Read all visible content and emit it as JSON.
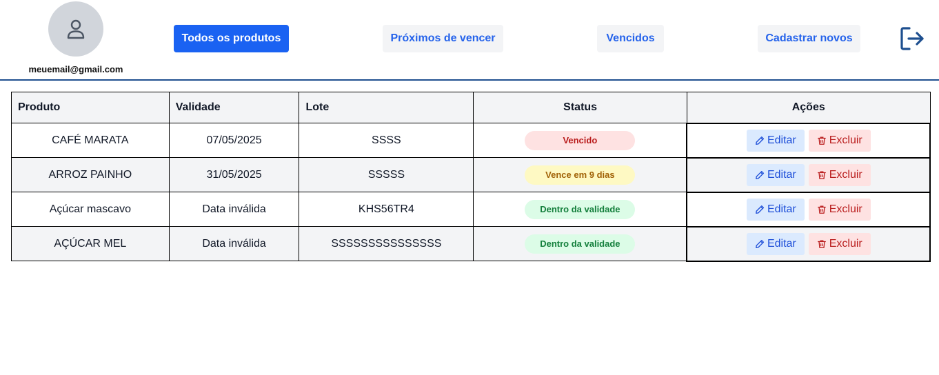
{
  "user": {
    "email": "meuemail@gmail.com",
    "avatar_icon": "user-icon"
  },
  "nav": {
    "all_products": "Todos os produtos",
    "expiring_soon": "Próximos de vencer",
    "expired": "Vencidos",
    "register_new": "Cadastrar novos",
    "logout_icon": "logout-icon"
  },
  "table": {
    "headers": {
      "product": "Produto",
      "validity": "Validade",
      "batch": "Lote",
      "status": "Status",
      "actions": "Ações"
    },
    "rows": [
      {
        "product": "CAFÉ MARATA",
        "validity": "07/05/2025",
        "batch": "SSSS",
        "status": "Vencido",
        "status_type": "expired"
      },
      {
        "product": "ARROZ PAINHO",
        "validity": "31/05/2025",
        "batch": "SSSSS",
        "status": "Vence em 9 dias",
        "status_type": "warning"
      },
      {
        "product": "Açúcar mascavo",
        "validity": "Data inválida",
        "batch": "KHS56TR4",
        "status": "Dentro da validade",
        "status_type": "valid"
      },
      {
        "product": "AÇÚCAR MEL",
        "validity": "Data inválida",
        "batch": "SSSSSSSSSSSSSSS",
        "status": "Dentro da validade",
        "status_type": "valid"
      }
    ],
    "edit_label": "Editar",
    "delete_label": "Excluir"
  },
  "colors": {
    "primary": "#1a62f2",
    "accent": "#1e4f8f",
    "expired": "#b91c1c",
    "warning": "#a16207",
    "valid": "#15803d"
  }
}
